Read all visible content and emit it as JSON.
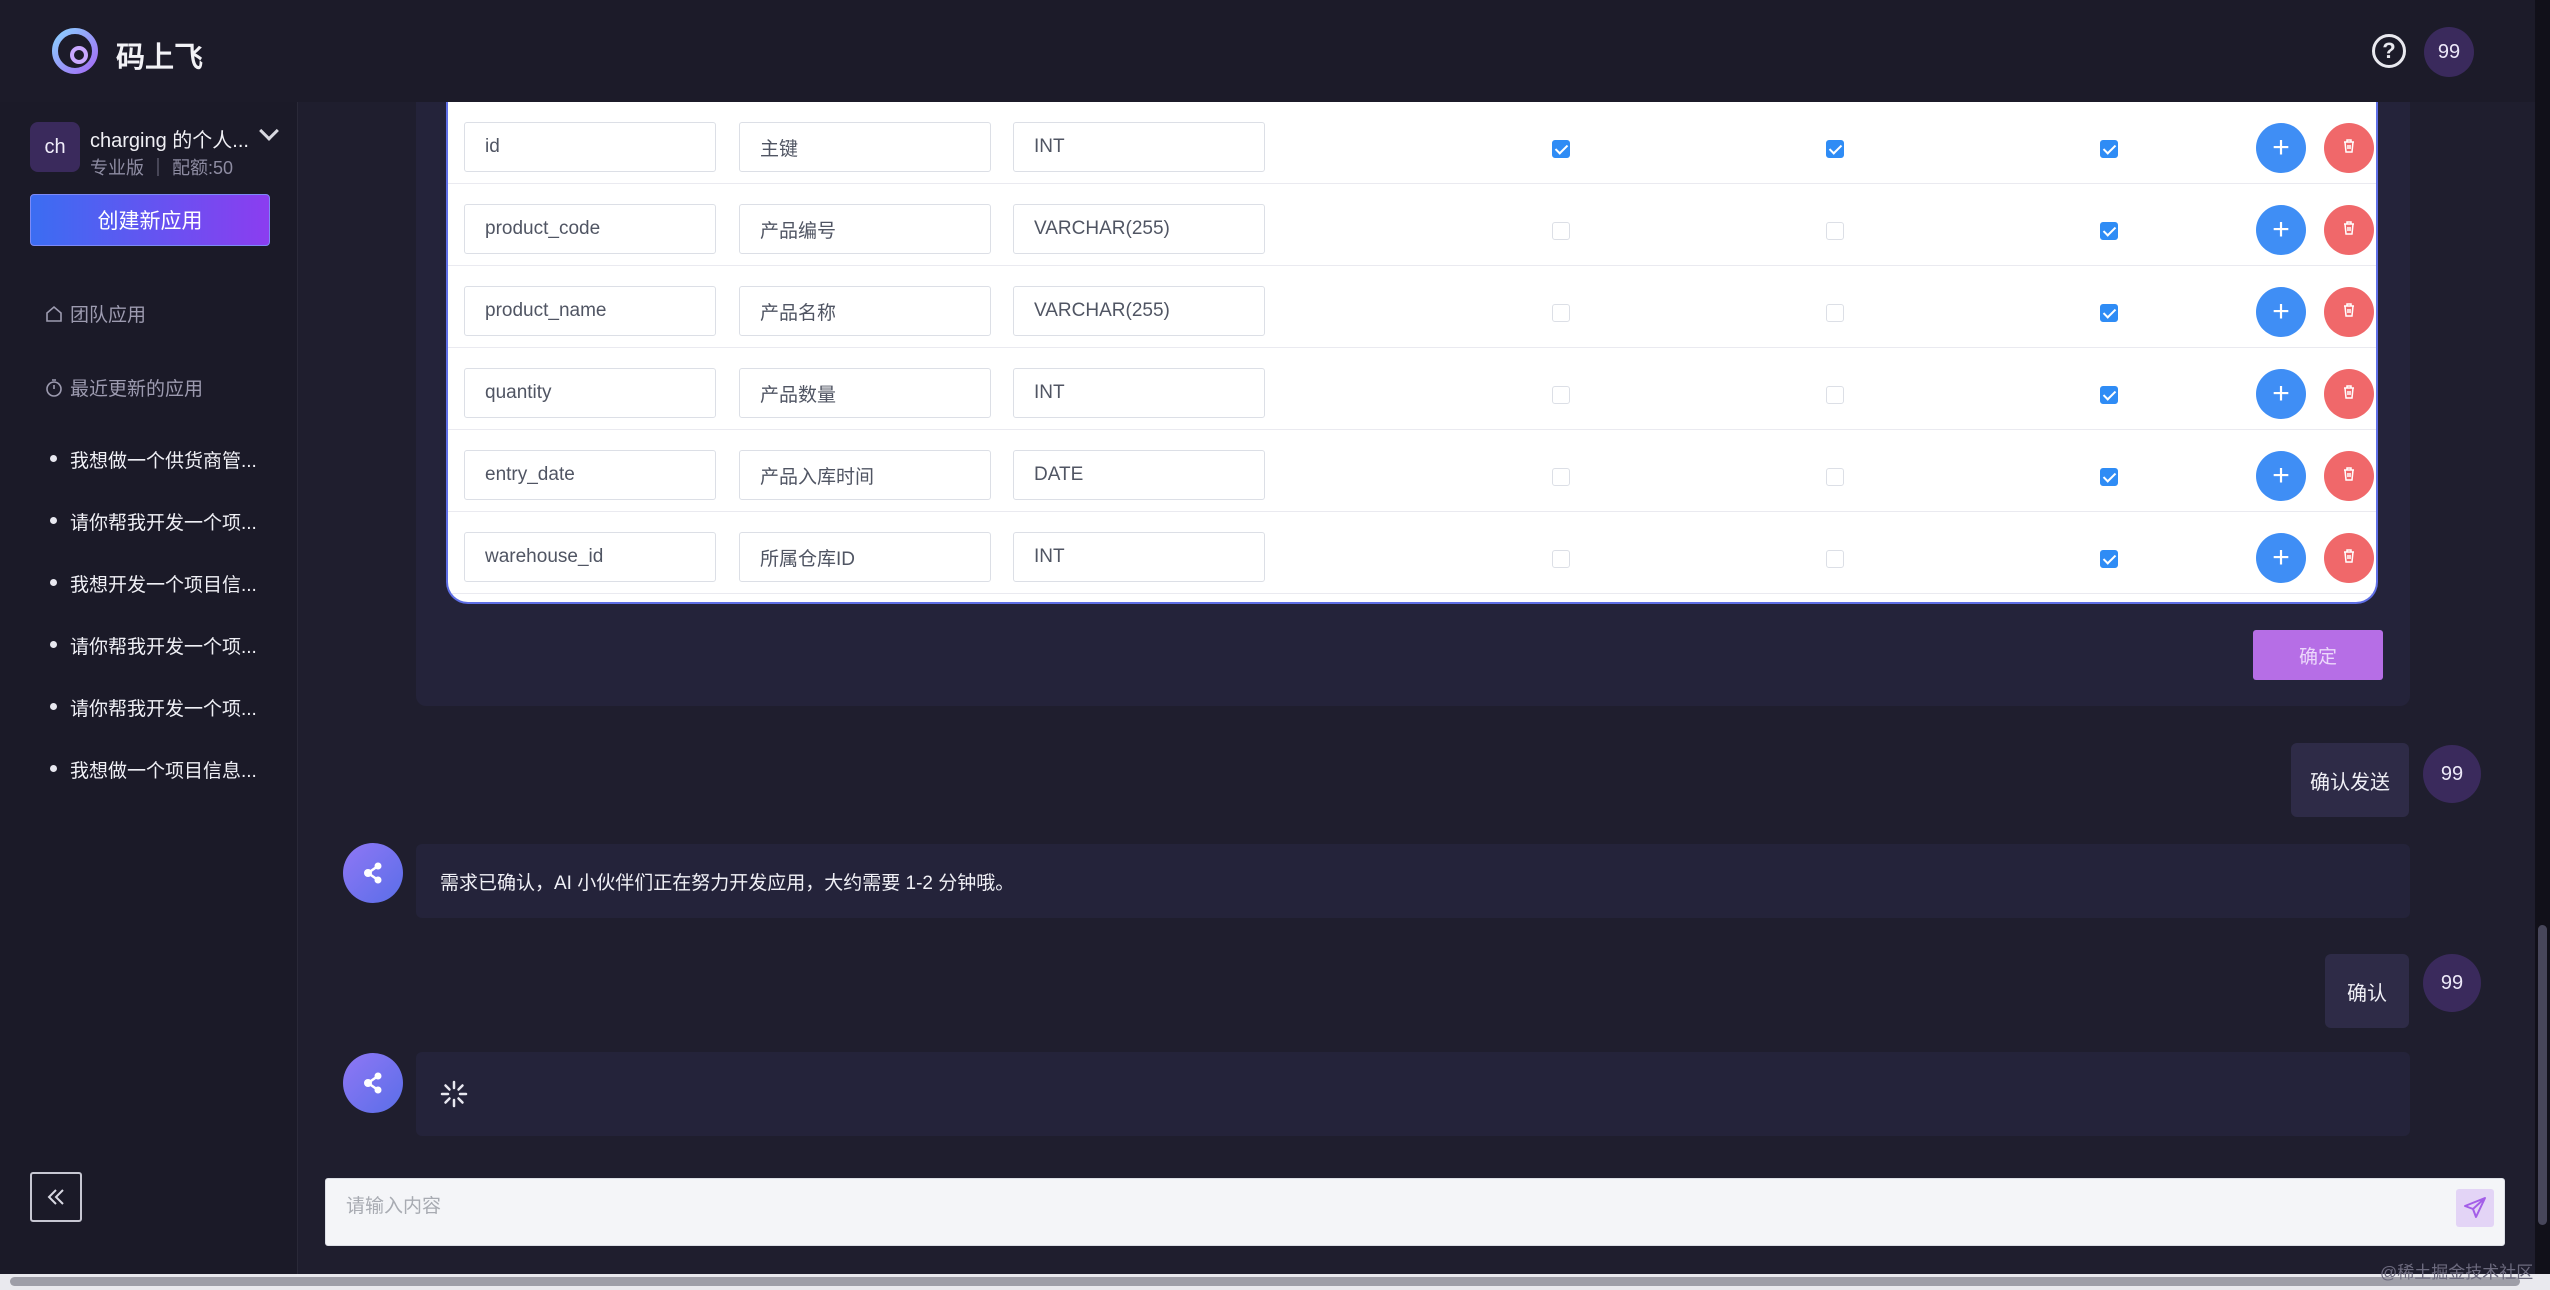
{
  "app": {
    "brand": "码上飞"
  },
  "header": {
    "avatar_text": "99",
    "help": "?"
  },
  "sidebar": {
    "account_initials": "ch",
    "account_name": "charging 的个人...",
    "account_plan": "专业版 ｜ 配额:50",
    "create_button": "创建新应用",
    "team_apps": "团队应用",
    "recent_title": "最近更新的应用",
    "recent_items": [
      "我想做一个供货商管...",
      "请你帮我开发一个项...",
      "我想开发一个项目信...",
      "请你帮我开发一个项...",
      "请你帮我开发一个项...",
      "我想做一个项目信息..."
    ]
  },
  "table": {
    "rows": [
      {
        "name": "id",
        "comment": "主键",
        "type": "INT",
        "c1": true,
        "c2": true,
        "c3": true
      },
      {
        "name": "product_code",
        "comment": "产品编号",
        "type": "VARCHAR(255)",
        "c1": false,
        "c2": false,
        "c3": true
      },
      {
        "name": "product_name",
        "comment": "产品名称",
        "type": "VARCHAR(255)",
        "c1": false,
        "c2": false,
        "c3": true
      },
      {
        "name": "quantity",
        "comment": "产品数量",
        "type": "INT",
        "c1": false,
        "c2": false,
        "c3": true
      },
      {
        "name": "entry_date",
        "comment": "产品入库时间",
        "type": "DATE",
        "c1": false,
        "c2": false,
        "c3": true
      },
      {
        "name": "warehouse_id",
        "comment": "所属仓库ID",
        "type": "INT",
        "c1": false,
        "c2": false,
        "c3": true
      }
    ],
    "confirm_button": "确定"
  },
  "chat": {
    "user_msg_1": "确认发送",
    "bot_msg_1": "需求已确认，AI 小伙伴们正在努力开发应用，大约需要 1-2 分钟哦。",
    "user_msg_2": "确认",
    "user_avatar": "99"
  },
  "composer": {
    "placeholder": "请输入内容"
  },
  "watermark": "@稀土掘金技术社区"
}
